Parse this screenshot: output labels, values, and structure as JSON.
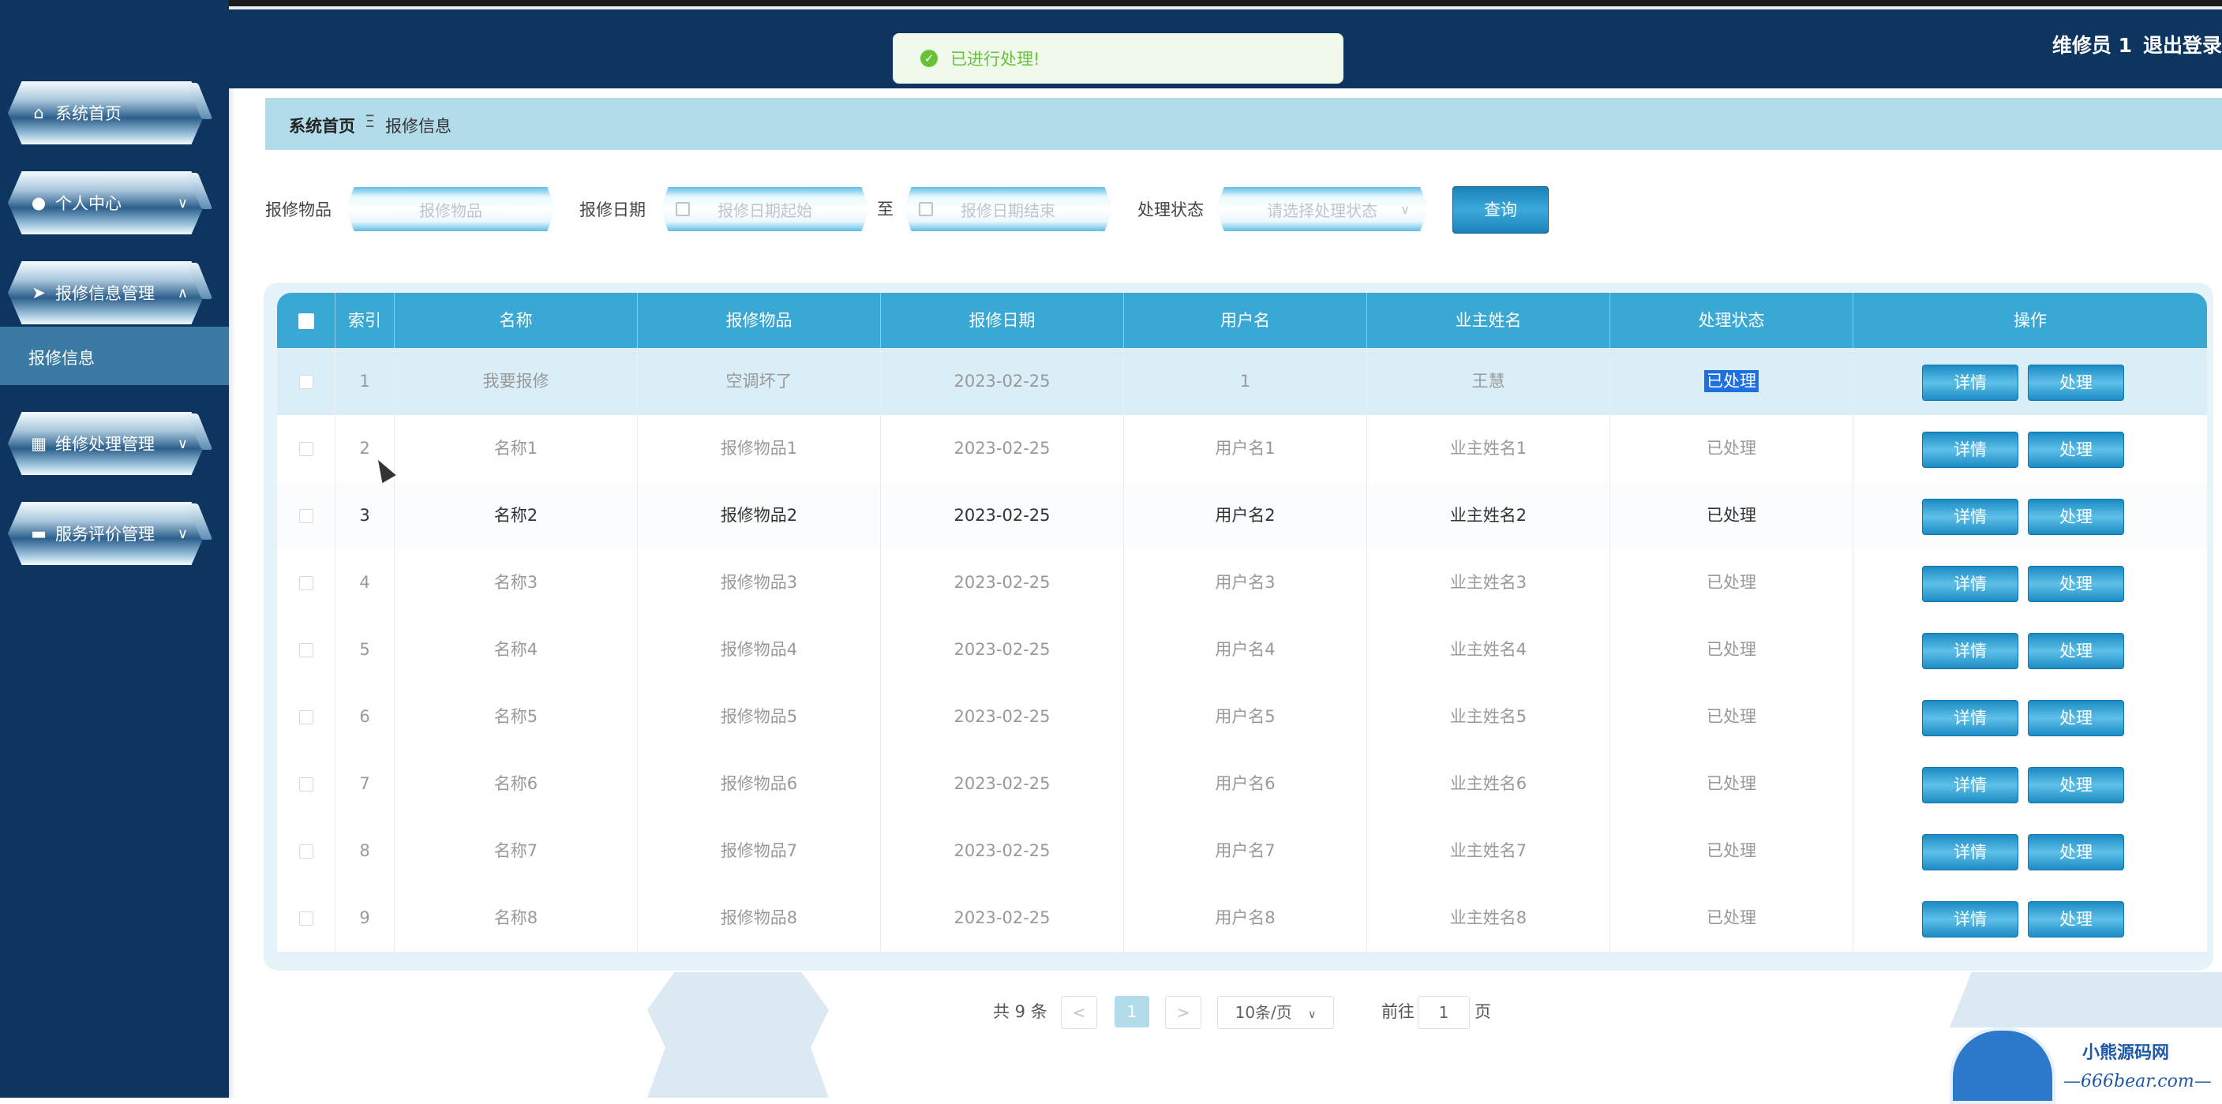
{
  "header": {
    "user_name": "维修员 1",
    "logout_label": "退出登录"
  },
  "toast": {
    "message": "已进行处理!"
  },
  "sidebar": {
    "items": [
      {
        "label": "系统首页",
        "icon": "home-icon"
      },
      {
        "label": "个人中心",
        "icon": "user-icon",
        "chevron": "∨"
      },
      {
        "label": "报修信息管理",
        "icon": "send-icon",
        "chevron": "∧"
      },
      {
        "label": "维修处理管理",
        "icon": "grid-icon",
        "chevron": "∨"
      },
      {
        "label": "服务评价管理",
        "icon": "ticket-icon",
        "chevron": "∨"
      }
    ],
    "submenu_active": "报修信息"
  },
  "breadcrumb": {
    "home": "系统首页",
    "separator": "Ξ",
    "current": "报修信息"
  },
  "filters": {
    "item_label": "报修物品",
    "item_placeholder": "报修物品",
    "date_label": "报修日期",
    "date_start_placeholder": "报修日期起始",
    "date_to": "至",
    "date_end_placeholder": "报修日期结束",
    "status_label": "处理状态",
    "status_placeholder": "请选择处理状态",
    "query_button": "查询"
  },
  "table": {
    "columns": [
      "索引",
      "名称",
      "报修物品",
      "报修日期",
      "用户名",
      "业主姓名",
      "处理状态",
      "操作"
    ],
    "rows": [
      {
        "index": "1",
        "name": "我要报修",
        "item": "空调坏了",
        "date": "2023-02-25",
        "username": "1",
        "owner": "王慧",
        "status": "已处理"
      },
      {
        "index": "2",
        "name": "名称1",
        "item": "报修物品1",
        "date": "2023-02-25",
        "username": "用户名1",
        "owner": "业主姓名1",
        "status": "已处理"
      },
      {
        "index": "3",
        "name": "名称2",
        "item": "报修物品2",
        "date": "2023-02-25",
        "username": "用户名2",
        "owner": "业主姓名2",
        "status": "已处理"
      },
      {
        "index": "4",
        "name": "名称3",
        "item": "报修物品3",
        "date": "2023-02-25",
        "username": "用户名3",
        "owner": "业主姓名3",
        "status": "已处理"
      },
      {
        "index": "5",
        "name": "名称4",
        "item": "报修物品4",
        "date": "2023-02-25",
        "username": "用户名4",
        "owner": "业主姓名4",
        "status": "已处理"
      },
      {
        "index": "6",
        "name": "名称5",
        "item": "报修物品5",
        "date": "2023-02-25",
        "username": "用户名5",
        "owner": "业主姓名5",
        "status": "已处理"
      },
      {
        "index": "7",
        "name": "名称6",
        "item": "报修物品6",
        "date": "2023-02-25",
        "username": "用户名6",
        "owner": "业主姓名6",
        "status": "已处理"
      },
      {
        "index": "8",
        "name": "名称7",
        "item": "报修物品7",
        "date": "2023-02-25",
        "username": "用户名7",
        "owner": "业主姓名7",
        "status": "已处理"
      },
      {
        "index": "9",
        "name": "名称8",
        "item": "报修物品8",
        "date": "2023-02-25",
        "username": "用户名8",
        "owner": "业主姓名8",
        "status": "已处理"
      }
    ],
    "detail_button": "详情",
    "process_button": "处理"
  },
  "pagination": {
    "total": "共 9 条",
    "prev": "<",
    "current_page": "1",
    "next": ">",
    "page_size": "10条/页",
    "goto_label": "前往",
    "goto_value": "1",
    "goto_suffix": "页"
  },
  "watermark": {
    "line1": "小熊源码网",
    "line2": "—666bear.com—"
  },
  "colors": {
    "top_bar": "#0e355f",
    "table_header": "#3aa8d4",
    "breadcrumb_bg": "#b3dcea",
    "toast_text": "#67c23a",
    "selected_row": "#d9eef6",
    "button": "#1c8bc4"
  }
}
